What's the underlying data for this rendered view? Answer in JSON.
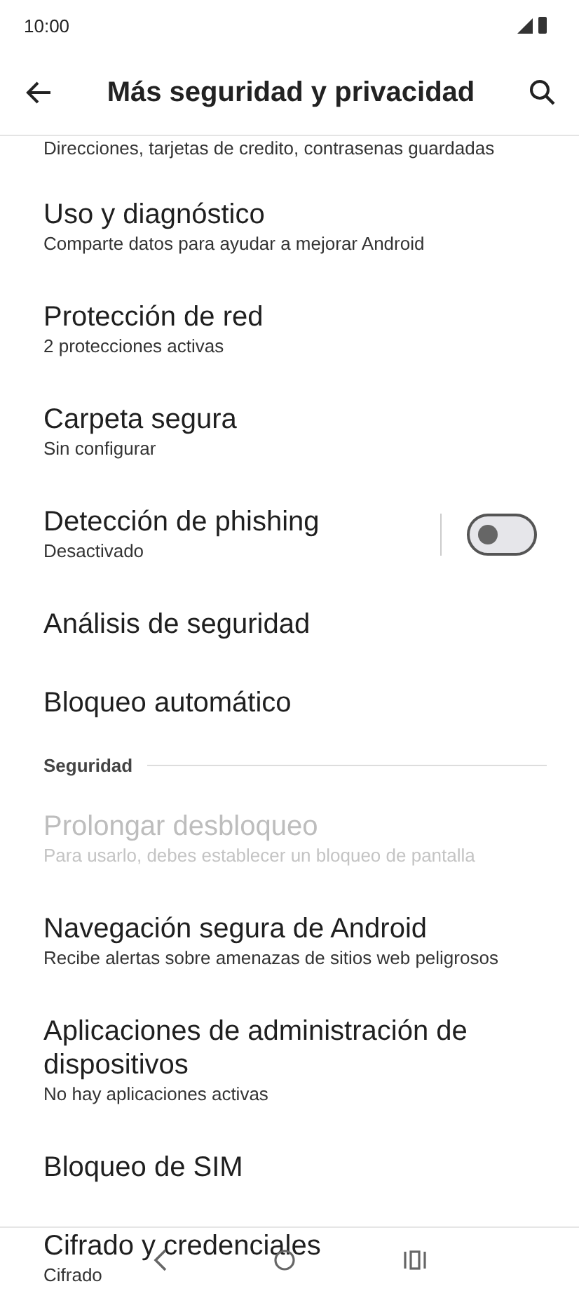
{
  "status_bar": {
    "time": "10:00"
  },
  "header": {
    "title": "Más seguridad y privacidad"
  },
  "items": [
    {
      "kind": "partial",
      "subtitle": "Direcciones, tarjetas de credito, contrasenas guardadas"
    },
    {
      "kind": "text",
      "title": "Uso y diagnóstico",
      "subtitle": "Comparte datos para ayudar a mejorar Android",
      "disabled": false
    },
    {
      "kind": "text",
      "title": "Protección de red",
      "subtitle": "2 protecciones activas",
      "disabled": false
    },
    {
      "kind": "text",
      "title": "Carpeta segura",
      "subtitle": "Sin configurar",
      "disabled": false
    },
    {
      "kind": "toggle",
      "title": "Detección de phishing",
      "subtitle": "Desactivado",
      "on": false,
      "disabled": false
    },
    {
      "kind": "text",
      "title": "Análisis de seguridad",
      "disabled": false
    },
    {
      "kind": "text",
      "title": "Bloqueo automático",
      "disabled": false
    },
    {
      "kind": "section",
      "title": "Seguridad"
    },
    {
      "kind": "text",
      "title": "Prolongar desbloqueo",
      "subtitle": "Para usarlo, debes establecer un bloqueo de pantalla",
      "disabled": true
    },
    {
      "kind": "text",
      "title": "Navegación segura de Android",
      "subtitle": "Recibe alertas sobre amenazas de sitios web peligrosos",
      "disabled": false
    },
    {
      "kind": "text",
      "title": "Aplicaciones de administración de dispositivos",
      "subtitle": "No hay aplicaciones activas",
      "disabled": false
    },
    {
      "kind": "text",
      "title": "Bloqueo de SIM",
      "disabled": false
    },
    {
      "kind": "text",
      "title": "Cifrado y credenciales",
      "subtitle": "Cifrado",
      "disabled": false
    }
  ]
}
